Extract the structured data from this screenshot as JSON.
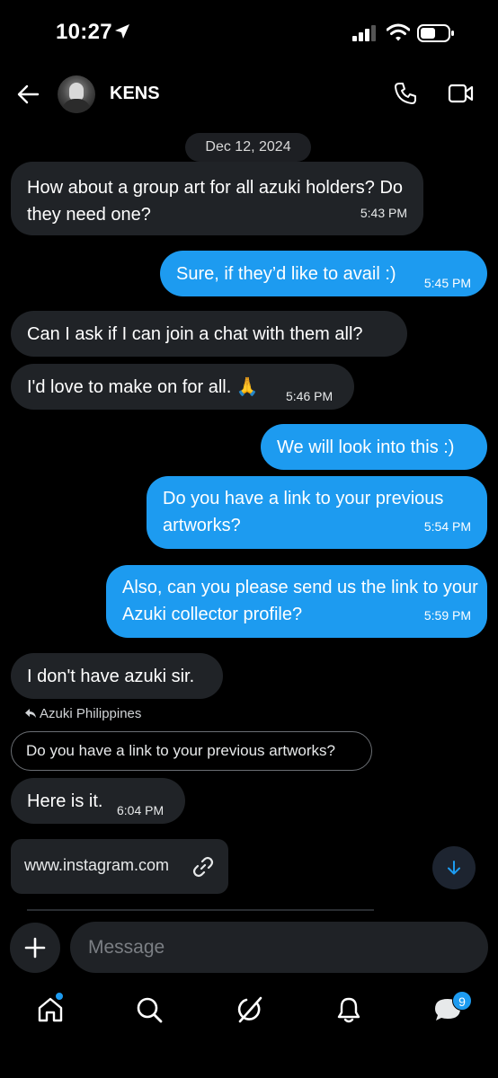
{
  "status_bar": {
    "time": "10:27"
  },
  "header": {
    "contact_name": "KENS"
  },
  "date_separator": "Dec 12, 2024",
  "messages": [
    {
      "direction": "in",
      "text": "How about a group art for all azuki holders? Do they need one?",
      "time": "5:43 PM"
    },
    {
      "direction": "out",
      "text": "Sure, if they’d like to avail :)",
      "time": "5:45 PM"
    },
    {
      "direction": "in",
      "text": "Can I ask if I can join a chat with them all?",
      "time": ""
    },
    {
      "direction": "in",
      "text": "I'd love to make on for all. 🙏",
      "time": "5:46 PM"
    },
    {
      "direction": "out",
      "text": "We will look into this :)",
      "time": ""
    },
    {
      "direction": "out",
      "text": "Do you have a link to your previous artworks?",
      "time": "5:54 PM"
    },
    {
      "direction": "out",
      "text": "Also, can you please send us the link to your Azuki collector profile?",
      "time": "5:59 PM"
    },
    {
      "direction": "in",
      "text": "I don't have azuki sir.",
      "time": ""
    },
    {
      "direction": "in",
      "text": "Here is it.",
      "time": "6:04 PM"
    }
  ],
  "reply": {
    "label": "Azuki Philippines",
    "quoted_text": "Do you have a link to your previous artworks?"
  },
  "link_card": {
    "text": "www.instagram.com"
  },
  "composer": {
    "placeholder": "Message"
  },
  "bottom_nav": {
    "items": [
      "home-icon",
      "search-icon",
      "grok-icon",
      "notifications-icon",
      "messages-icon"
    ],
    "messages_badge": "9"
  },
  "colors": {
    "accent": "#1d9bf0",
    "incoming_bubble": "#202327",
    "background": "#000000"
  }
}
